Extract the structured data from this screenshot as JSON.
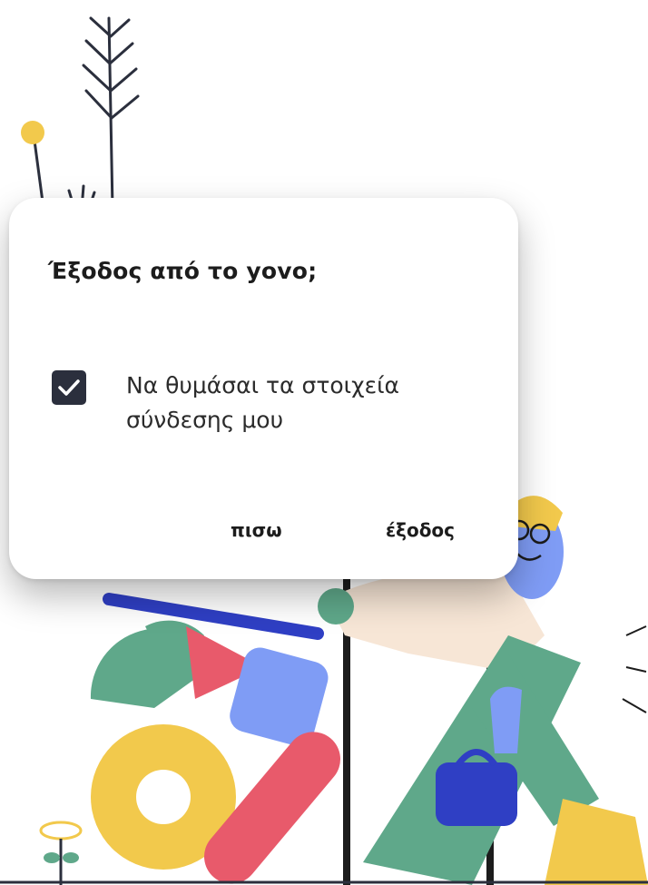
{
  "dialog": {
    "title": "Έξοδος από το yovo;",
    "remember_label": "Να θυμάσαι τα στοιχεία σύνδεσης μου",
    "remember_checked": true,
    "back_label": "πισω",
    "exit_label": "έξοδος"
  },
  "icons": {
    "checkbox": "check-icon"
  },
  "colors": {
    "dialog_bg": "#ffffff",
    "checkbox_bg": "#2b2f3d",
    "text": "#1c1c1c",
    "yellow": "#f2c94c",
    "green": "#5fa88a",
    "red": "#e85a6b",
    "blue": "#2f3fc4",
    "light_blue": "#7f9cf5",
    "skin": "#f7e6d6"
  }
}
